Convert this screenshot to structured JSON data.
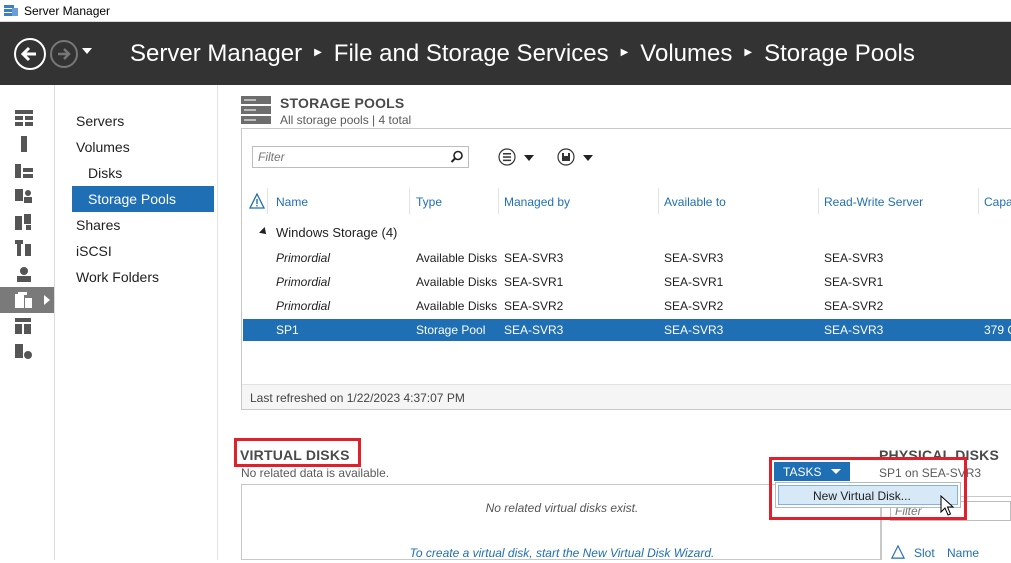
{
  "window": {
    "title": "Server Manager"
  },
  "header": {
    "breadcrumbs": [
      "Server Manager",
      "File and Storage Services",
      "Volumes",
      "Storage Pools"
    ]
  },
  "subnav": {
    "items": [
      {
        "label": "Servers"
      },
      {
        "label": "Volumes"
      },
      {
        "label": "Disks"
      },
      {
        "label": "Storage Pools"
      },
      {
        "label": "Shares"
      },
      {
        "label": "iSCSI"
      },
      {
        "label": "Work Folders"
      }
    ]
  },
  "storage_pools": {
    "title": "STORAGE POOLS",
    "subtitle": "All storage pools | 4 total",
    "filter_placeholder": "Filter",
    "columns": [
      "Name",
      "Type",
      "Managed by",
      "Available to",
      "Read-Write Server",
      "Capa"
    ],
    "group": "Windows Storage (4)",
    "rows": [
      {
        "name": "Primordial",
        "type": "Available Disks",
        "managed_by": "SEA-SVR3",
        "available_to": "SEA-SVR3",
        "rw_server": "SEA-SVR3",
        "capacity": ""
      },
      {
        "name": "Primordial",
        "type": "Available Disks",
        "managed_by": "SEA-SVR1",
        "available_to": "SEA-SVR1",
        "rw_server": "SEA-SVR1",
        "capacity": ""
      },
      {
        "name": "Primordial",
        "type": "Available Disks",
        "managed_by": "SEA-SVR2",
        "available_to": "SEA-SVR2",
        "rw_server": "SEA-SVR2",
        "capacity": ""
      },
      {
        "name": "SP1",
        "type": "Storage Pool",
        "managed_by": "SEA-SVR3",
        "available_to": "SEA-SVR3",
        "rw_server": "SEA-SVR3",
        "capacity": "379 G"
      }
    ],
    "last_refreshed": "Last refreshed on 1/22/2023 4:37:07 PM"
  },
  "virtual_disks": {
    "title": "VIRTUAL DISKS",
    "subtitle": "No related data is available.",
    "empty_text": "No related virtual disks exist.",
    "link_text": "To create a virtual disk, start the New Virtual Disk Wizard."
  },
  "tasks": {
    "label": "TASKS",
    "menu_items": [
      "New Virtual Disk..."
    ]
  },
  "physical_disks": {
    "title": "PHYSICAL DISKS",
    "subtitle": "SP1 on SEA-SVR3",
    "filter_placeholder": "Filter",
    "columns": [
      "Slot",
      "Name"
    ]
  },
  "colors": {
    "accent": "#1f6fb5",
    "header_bg": "#333333",
    "highlight": "#e0202a"
  }
}
